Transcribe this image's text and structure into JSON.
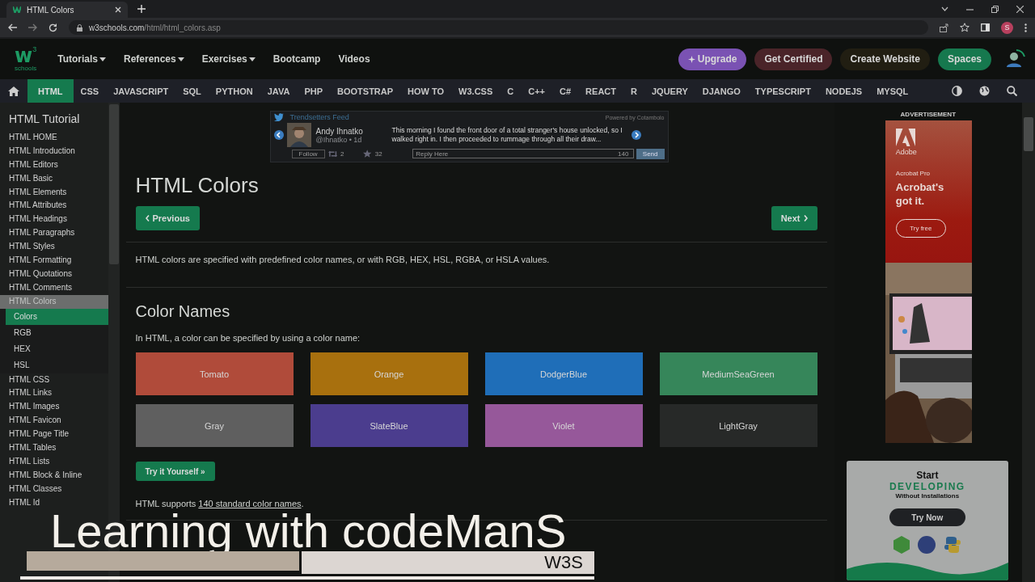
{
  "browser": {
    "tab_title": "HTML Colors",
    "url_domain": "w3schools.com",
    "url_path": "/html/html_colors.asp",
    "profile_initial": "S"
  },
  "header": {
    "logo_mark": "w",
    "logo_sup": "3",
    "logo_text": "schools",
    "nav": [
      {
        "label": "Tutorials",
        "dropdown": true
      },
      {
        "label": "References",
        "dropdown": true
      },
      {
        "label": "Exercises",
        "dropdown": true
      },
      {
        "label": "Bootcamp",
        "dropdown": false
      },
      {
        "label": "Videos",
        "dropdown": false
      }
    ],
    "buttons": [
      {
        "label": "Upgrade",
        "color": "#7a52b3"
      },
      {
        "label": "Get Certified",
        "color": "#4a2429"
      },
      {
        "label": "Create Website",
        "color": "#211e12"
      },
      {
        "label": "Spaces",
        "color": "#16784e"
      }
    ]
  },
  "topnav": {
    "items": [
      {
        "label": "HTML",
        "selected": true
      },
      {
        "label": "CSS",
        "selected": false
      },
      {
        "label": "JAVASCRIPT",
        "selected": false
      },
      {
        "label": "SQL",
        "selected": false
      },
      {
        "label": "PYTHON",
        "selected": false
      },
      {
        "label": "JAVA",
        "selected": false
      },
      {
        "label": "PHP",
        "selected": false
      },
      {
        "label": "BOOTSTRAP",
        "selected": false
      },
      {
        "label": "HOW TO",
        "selected": false
      },
      {
        "label": "W3.CSS",
        "selected": false
      },
      {
        "label": "C",
        "selected": false
      },
      {
        "label": "C++",
        "selected": false
      },
      {
        "label": "C#",
        "selected": false
      },
      {
        "label": "REACT",
        "selected": false
      },
      {
        "label": "R",
        "selected": false
      },
      {
        "label": "JQUERY",
        "selected": false
      },
      {
        "label": "DJANGO",
        "selected": false
      },
      {
        "label": "TYPESCRIPT",
        "selected": false
      },
      {
        "label": "NODEJS",
        "selected": false
      },
      {
        "label": "MYSQL",
        "selected": false
      }
    ]
  },
  "sidebar": {
    "title": "HTML Tutorial",
    "items": [
      {
        "label": "HTML HOME",
        "selected": false
      },
      {
        "label": "HTML Introduction",
        "selected": false
      },
      {
        "label": "HTML Editors",
        "selected": false
      },
      {
        "label": "HTML Basic",
        "selected": false
      },
      {
        "label": "HTML Elements",
        "selected": false
      },
      {
        "label": "HTML Attributes",
        "selected": false
      },
      {
        "label": "HTML Headings",
        "selected": false
      },
      {
        "label": "HTML Paragraphs",
        "selected": false
      },
      {
        "label": "HTML Styles",
        "selected": false
      },
      {
        "label": "HTML Formatting",
        "selected": false
      },
      {
        "label": "HTML Quotations",
        "selected": false
      },
      {
        "label": "HTML Comments",
        "selected": false
      },
      {
        "label": "HTML Colors",
        "selected": true,
        "children": [
          {
            "label": "Colors",
            "selected": true
          },
          {
            "label": "RGB",
            "selected": false
          },
          {
            "label": "HEX",
            "selected": false
          },
          {
            "label": "HSL",
            "selected": false
          }
        ]
      },
      {
        "label": "HTML CSS",
        "selected": false
      },
      {
        "label": "HTML Links",
        "selected": false
      },
      {
        "label": "HTML Images",
        "selected": false
      },
      {
        "label": "HTML Favicon",
        "selected": false
      },
      {
        "label": "HTML Page Title",
        "selected": false
      },
      {
        "label": "HTML Tables",
        "selected": false
      },
      {
        "label": "HTML Lists",
        "selected": false
      },
      {
        "label": "HTML Block & Inline",
        "selected": false
      },
      {
        "label": "HTML Classes",
        "selected": false
      },
      {
        "label": "HTML Id",
        "selected": false
      }
    ]
  },
  "feed": {
    "title": "Trendsetters Feed",
    "powered_by": "Powered by Cotambolo",
    "author": "Andy Ihnatko",
    "handle": "@Ihnatko • 1d",
    "text": "This morning I found the front door of a total stranger's house unlocked, so I walked right in. I then proceeded to rummage through all their draw...",
    "follow": "Follow",
    "retweets": "2",
    "favorites": "32",
    "reply_placeholder": "Reply Here",
    "char_count": "140",
    "send": "Send"
  },
  "article": {
    "title": "HTML Colors",
    "prev": "Previous",
    "next": "Next",
    "intro": "HTML colors are specified with predefined color names, or with RGB, HEX, HSL, RGBA, or HSLA values.",
    "section_title": "Color Names",
    "section_text": "In HTML, a color can be specified by using a color name:",
    "swatches": [
      {
        "name": "Tomato",
        "color": "#b04b3a"
      },
      {
        "name": "Orange",
        "color": "#a8700e"
      },
      {
        "name": "DodgerBlue",
        "color": "#1f6eb8"
      },
      {
        "name": "MediumSeaGreen",
        "color": "#36865a"
      },
      {
        "name": "Gray",
        "color": "#5f5f5f"
      },
      {
        "name": "SlateBlue",
        "color": "#4b3d8e"
      },
      {
        "name": "Violet",
        "color": "#96589a"
      },
      {
        "name": "LightGray",
        "color": "#272928"
      }
    ],
    "try_button": "Try it Yourself »",
    "note_before": "HTML supports ",
    "note_link": "140 standard color names",
    "note_after": "."
  },
  "ads": {
    "label": "ADVERTISEMENT",
    "brand": "Adobe",
    "product": "Acrobat Pro",
    "headline": "Acrobat's got it.",
    "button": "Try free",
    "promo": {
      "line1": "Start",
      "line2": "DEVELOPING",
      "line3": "Without Installations",
      "button": "Try Now"
    }
  },
  "overlay": {
    "caption": "Learning with codeManS",
    "tag": "W3S"
  }
}
